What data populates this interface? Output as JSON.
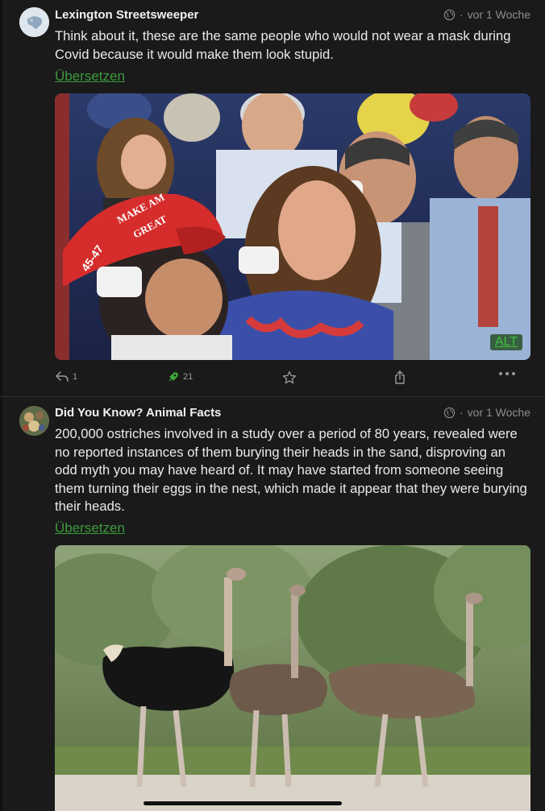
{
  "posts": [
    {
      "author": "Lexington Streetsweeper",
      "time": "vor 1 Woche",
      "text": "Think about it, these are the same people who would not wear a mask during Covid because it would make them look stupid.",
      "translate_label": "Übersetzen",
      "image_alt_badge": "ALT",
      "image_hat_text_1": "MAKE AM",
      "image_hat_text_2": "GREAT",
      "image_hat_text_3": "45-47",
      "actions": {
        "reply_count": "1",
        "boost_count": "21"
      }
    },
    {
      "author": "Did You Know? Animal Facts",
      "time": "vor 1 Woche",
      "text": "200,000 ostriches involved in a study over a period of 80 years, revealed were no reported instances of them burying their heads in the sand, disproving an odd myth you may have heard of. It may have started from someone seeing them turning their eggs in the nest, which made it appear that they were burying their heads.",
      "translate_label": "Übersetzen"
    }
  ],
  "icons": [
    "globe-icon",
    "reply-icon",
    "boost-icon",
    "favourite-icon",
    "share-icon",
    "more-icon"
  ],
  "colors": {
    "background": "#1a1a1a",
    "accent_green": "#3d9b3d",
    "muted": "#8d8d8d"
  }
}
